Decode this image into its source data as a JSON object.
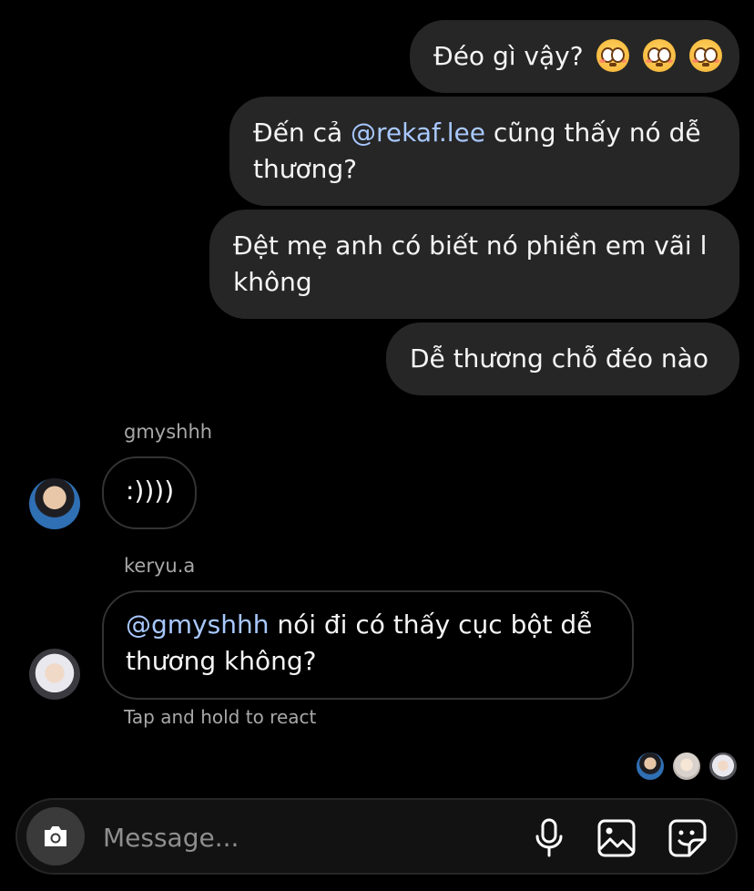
{
  "messages_out": [
    {
      "text": "Đéo gì vậy?",
      "emoji": [
        "flushed-face-emoji",
        "flushed-face-emoji",
        "flushed-face-emoji"
      ]
    },
    {
      "mention": "@rekaf.lee",
      "pre": "Đến cả ",
      "post": " cũng thấy nó dễ",
      "line2": "thương?"
    },
    {
      "line1": "Đệt mẹ anh có biết nó phiền em vãi l",
      "line2": "không"
    },
    {
      "text": "Dễ thương chỗ đéo nào"
    }
  ],
  "incoming": [
    {
      "sender": "gmyshhh",
      "text": ":))))"
    },
    {
      "sender": "keryu.a",
      "mention": "@gmyshhh",
      "line1_rest": " nói đi có thấy cục bột dễ",
      "line2": "thương không?"
    }
  ],
  "hint": "Tap and hold to react",
  "composer": {
    "placeholder": "Message..."
  },
  "colors": {
    "outgoing_bubble": "#262626",
    "mention": "#a8c8ff",
    "meta_text": "#a8a8a8",
    "background": "#000000"
  }
}
